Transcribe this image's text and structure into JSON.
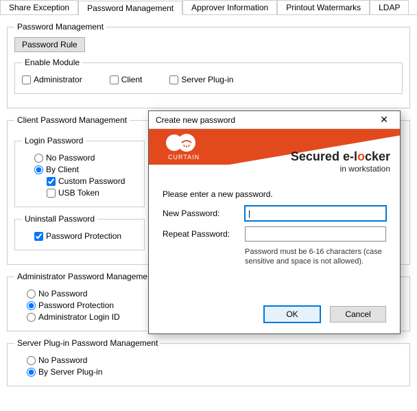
{
  "tabs": {
    "share_exception": "Share Exception",
    "password_management": "Password Management",
    "approver_information": "Approver Information",
    "printout_watermarks": "Printout Watermarks",
    "ldap": "LDAP"
  },
  "password_mgmt": {
    "legend": "Password Management",
    "rule_btn": "Password Rule",
    "enable_module": {
      "legend": "Enable Module",
      "administrator": "Administrator",
      "client": "Client",
      "server_plugin": "Server Plug-in"
    }
  },
  "client_pw": {
    "legend": "Client Password Management",
    "login": {
      "legend": "Login Password",
      "no_password": "No Password",
      "by_client": "By Client",
      "custom_password": "Custom Password",
      "usb_token": "USB Token"
    },
    "uninstall": {
      "legend": "Uninstall Password",
      "password_protection": "Password Protection"
    }
  },
  "admin_pw": {
    "legend": "Administrator Password Management",
    "no_password": "No Password",
    "password_protection": "Password Protection",
    "admin_login_id": "Administrator Login ID"
  },
  "server_pw": {
    "legend": "Server Plug-in Password Management",
    "no_password": "No Password",
    "by_server_plugin": "By Server Plug-in"
  },
  "modal": {
    "title": "Create new password",
    "close": "✕",
    "logo_text": "CURTAIN",
    "brand_main_pre": "Secured e-l",
    "brand_main_o": "o",
    "brand_main_post": "cker",
    "brand_sub": "in workstation",
    "prompt": "Please enter a new password.",
    "new_pw_label": "New Password:",
    "repeat_pw_label": "Repeat Password:",
    "hint": "Password must be 6-16 characters (case sensitive and space is not allowed).",
    "ok": "OK",
    "cancel": "Cancel"
  }
}
